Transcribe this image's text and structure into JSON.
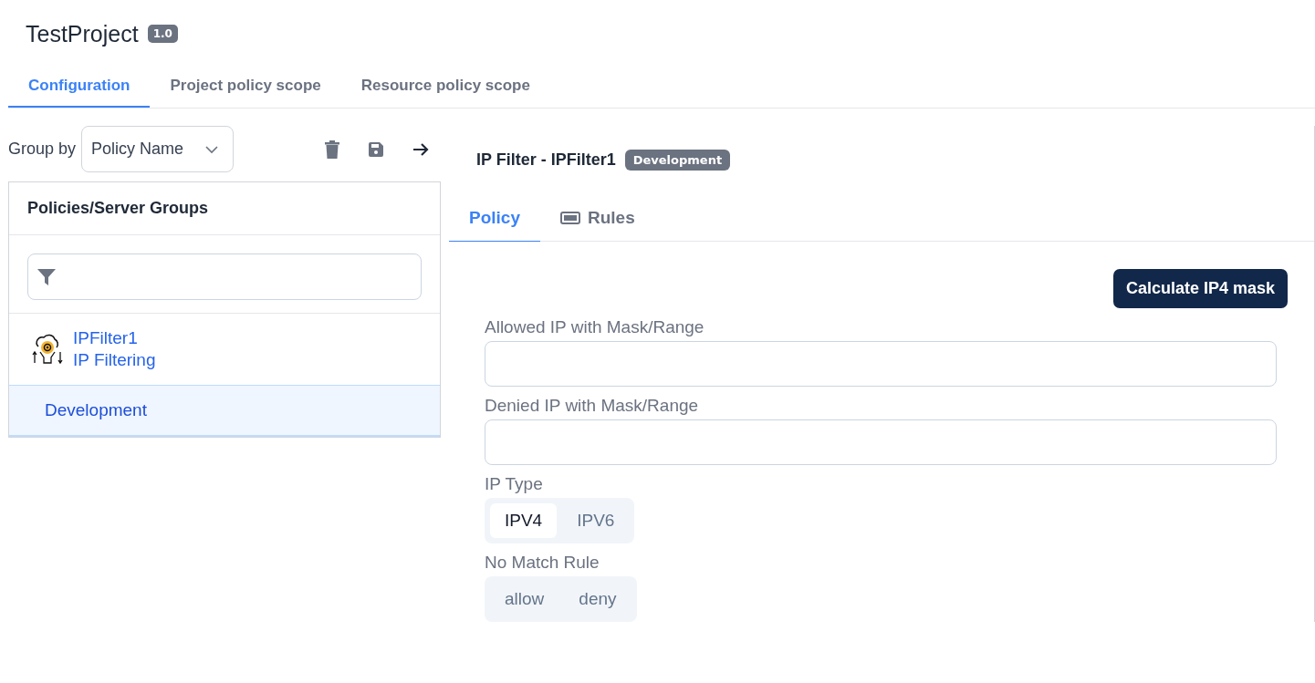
{
  "project": {
    "title": "TestProject",
    "version": "1.0"
  },
  "tabs": [
    {
      "label": "Configuration",
      "selected": true
    },
    {
      "label": "Project policy scope",
      "selected": false
    },
    {
      "label": "Resource policy scope",
      "selected": false
    }
  ],
  "group_by": {
    "label": "Group by",
    "value": "Policy Name"
  },
  "tree_panel": {
    "header": "Policies/Server Groups",
    "items": [
      {
        "name": "IPFilter1",
        "type": "IP Filtering",
        "selected": false,
        "children": [
          {
            "name": "Development",
            "selected": true
          }
        ]
      }
    ]
  },
  "detail": {
    "title": "IP Filter - IPFilter1",
    "badge": "Development",
    "tabs": [
      {
        "label": "Policy",
        "selected": true,
        "kind": "plain"
      },
      {
        "label": "Rules",
        "selected": false,
        "kind": "icon"
      }
    ],
    "calculate_button": "Calculate IP4 mask",
    "fields": [
      {
        "label": "Allowed IP with Mask/Range"
      },
      {
        "label": "Denied IP with Mask/Range"
      }
    ],
    "segments": [
      {
        "label": "IP Type",
        "options": [
          {
            "label": "IPV4",
            "selected": true
          },
          {
            "label": "IPV6",
            "selected": false
          }
        ]
      },
      {
        "label": "No Match Rule",
        "options": [
          {
            "label": "allow",
            "selected": false
          },
          {
            "label": "deny",
            "selected": false
          }
        ]
      }
    ]
  }
}
